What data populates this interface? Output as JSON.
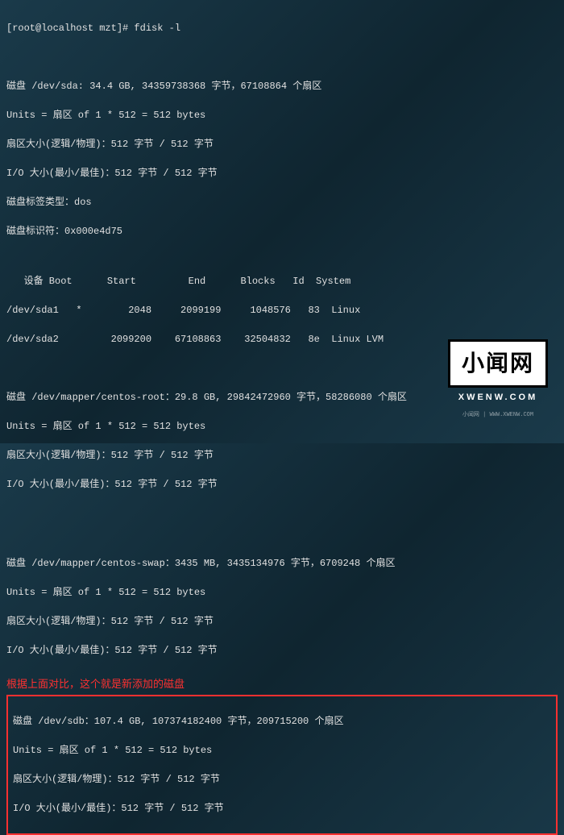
{
  "prompt": "[root@localhost mzt]# fdisk -l",
  "disk_sda": {
    "header": "磁盘 /dev/sda: 34.4 GB, 34359738368 字节，67108864 个扇区",
    "units": "Units = 扇区 of 1 * 512 = 512 bytes",
    "sector": "扇区大小(逻辑/物理)：512 字节 / 512 字节",
    "io": "I/O 大小(最小/最佳)：512 字节 / 512 字节",
    "label": "磁盘标签类型：dos",
    "ident": "磁盘标识符：0x000e4d75"
  },
  "partition_table": {
    "header": "   设备 Boot      Start         End      Blocks   Id  System",
    "rows": [
      "/dev/sda1   *        2048     2099199     1048576   83  Linux",
      "/dev/sda2         2099200    67108863    32504832   8e  Linux LVM"
    ]
  },
  "disk_root": {
    "header": "磁盘 /dev/mapper/centos-root：29.8 GB, 29842472960 字节，58286080 个扇区",
    "units": "Units = 扇区 of 1 * 512 = 512 bytes",
    "sector": "扇区大小(逻辑/物理)：512 字节 / 512 字节",
    "io": "I/O 大小(最小/最佳)：512 字节 / 512 字节"
  },
  "disk_swap": {
    "header": "磁盘 /dev/mapper/centos-swap：3435 MB, 3435134976 字节，6709248 个扇区",
    "units": "Units = 扇区 of 1 * 512 = 512 bytes",
    "sector": "扇区大小(逻辑/物理)：512 字节 / 512 字节",
    "io": "I/O 大小(最小/最佳)：512 字节 / 512 字节"
  },
  "annotation": "根据上面对比，这个就是新添加的磁盘",
  "disk_sdb": {
    "header": "磁盘 /dev/sdb：107.4 GB, 107374182400 字节，209715200 个扇区",
    "units": "Units = 扇区 of 1 * 512 = 512 bytes",
    "sector": "扇区大小(逻辑/物理)：512 字节 / 512 字节",
    "io": "I/O 大小(最小/最佳)：512 字节 / 512 字节"
  },
  "watermark": {
    "main": "小闻网",
    "sub": "XWENW.COM",
    "tiny": "小闻网 | WWW.XWENW.COM"
  }
}
